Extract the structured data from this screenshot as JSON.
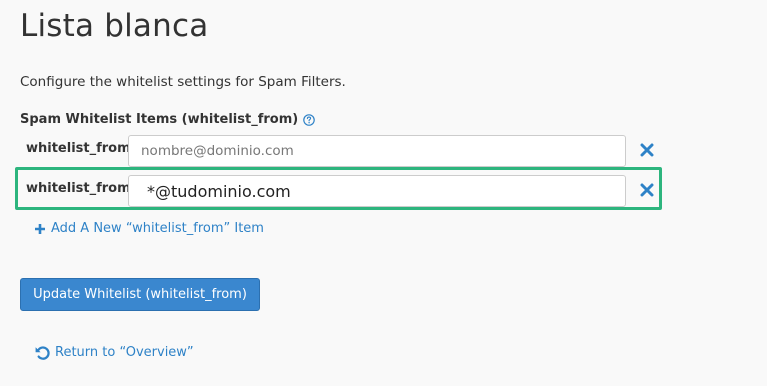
{
  "page": {
    "title": "Lista blanca",
    "description": "Configure the whitelist settings for Spam Filters."
  },
  "whitelist": {
    "section_label": "Spam Whitelist Items (whitelist_from)",
    "items": [
      {
        "label": "whitelist_from",
        "value": "",
        "placeholder": "nombre@dominio.com"
      },
      {
        "label": "whitelist_from",
        "value": "*@tudominio.com",
        "placeholder": ""
      }
    ],
    "add_label": "Add A New “whitelist_from” Item"
  },
  "actions": {
    "update_label": "Update Whitelist (whitelist_from)",
    "return_label": "Return to “Overview”"
  },
  "icons": {
    "help": "question-circle-icon",
    "remove": "close-x-icon",
    "add": "plus-icon",
    "return": "undo-icon"
  },
  "colors": {
    "accent": "#2e82c7",
    "button": "#3a87cf",
    "highlight": "#2db57e"
  }
}
